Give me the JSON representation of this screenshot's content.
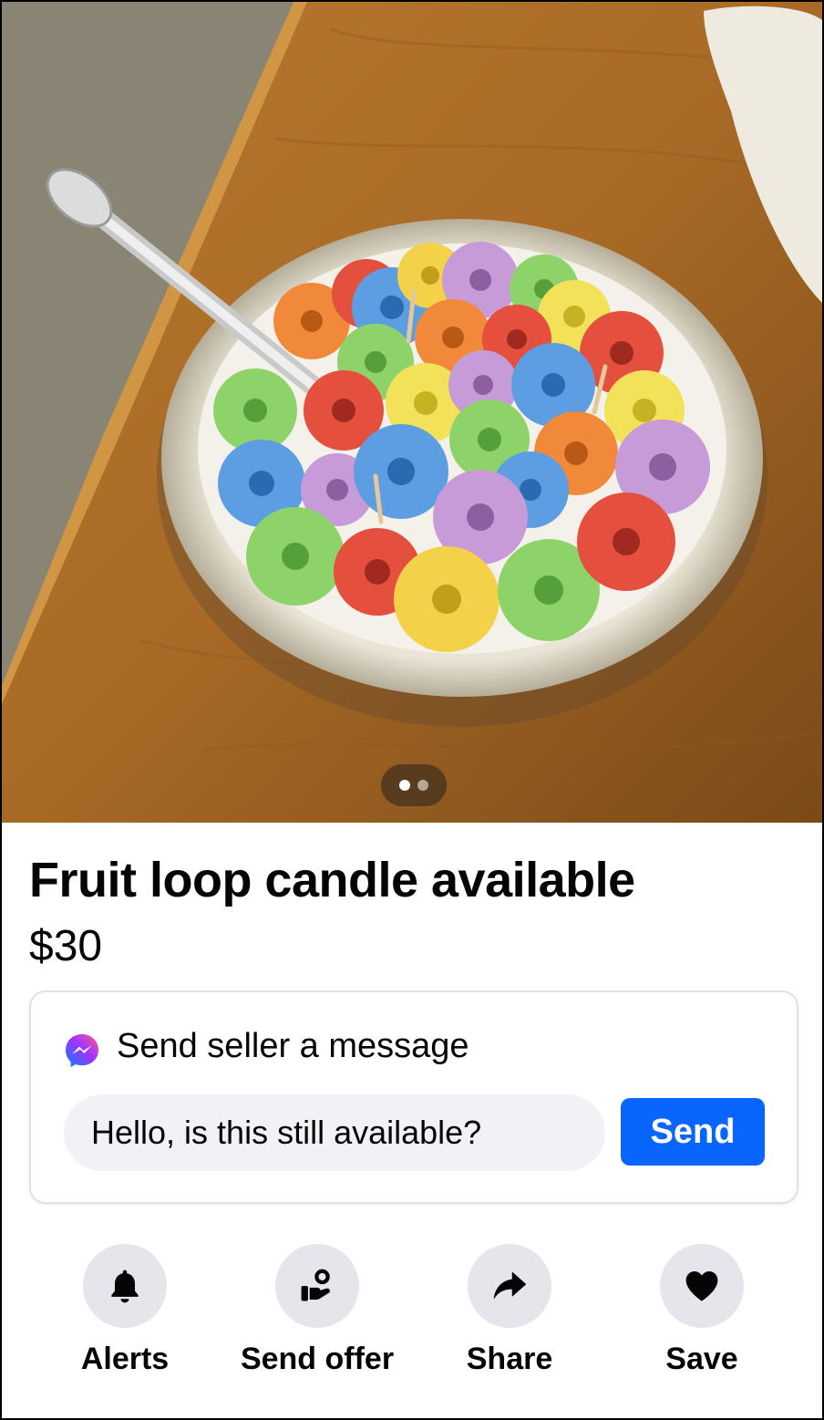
{
  "listing": {
    "title": "Fruit loop candle available",
    "price": "$30",
    "photo": {
      "subject": "fruit-loop-cereal-candle",
      "page_count": 2,
      "current_page": 1
    }
  },
  "message": {
    "heading": "Send seller a message",
    "icon": "messenger-icon",
    "input_value": "Hello, is this still available?",
    "send_label": "Send"
  },
  "actions": [
    {
      "label": "Alerts",
      "icon": "bell-icon"
    },
    {
      "label": "Send offer",
      "icon": "offer-icon"
    },
    {
      "label": "Share",
      "icon": "share-arrow-icon"
    },
    {
      "label": "Save",
      "icon": "heart-icon"
    }
  ],
  "colors": {
    "accent": "#0866ff",
    "action_circle": "#e4e6eb",
    "input_bg": "#f0f2f5"
  }
}
